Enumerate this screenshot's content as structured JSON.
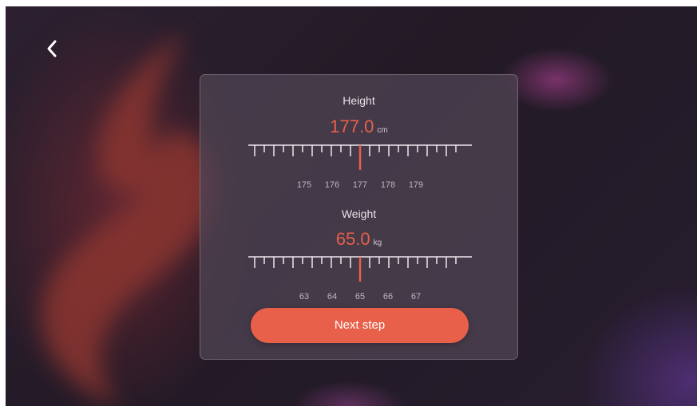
{
  "colors": {
    "accent": "#e9604a",
    "value_text": "#e8604a",
    "card_bg": "#4e4252",
    "screen_bg": "#2a1e2a"
  },
  "nav": {
    "back_icon": "chevron-left-icon"
  },
  "height": {
    "label": "Height",
    "value": "177.0",
    "unit": "cm",
    "ticks": [
      "175",
      "176",
      "177",
      "178",
      "179"
    ],
    "selected": 177
  },
  "weight": {
    "label": "Weight",
    "value": "65.0",
    "unit": "kg",
    "ticks": [
      "63",
      "64",
      "65",
      "66",
      "67"
    ],
    "selected": 65
  },
  "next_button": {
    "label": "Next step"
  }
}
